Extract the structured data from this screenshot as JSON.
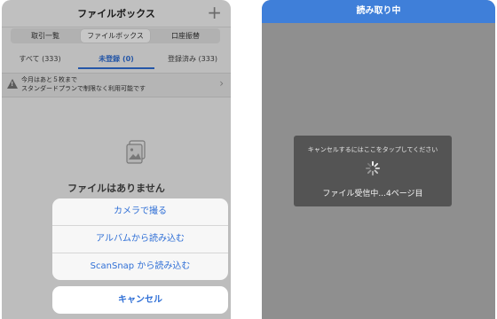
{
  "left_screen": {
    "nav_title": "ファイルボックス",
    "add_icon": "plus-icon",
    "segments": [
      "取引一覧",
      "ファイルボックス",
      "口座振替"
    ],
    "active_segment": 1,
    "tabs": [
      "すべて (333)",
      "未登録 (0)",
      "登録済み (333)"
    ],
    "active_tab": 1,
    "notice": {
      "line1": "今月はあと５枚まで",
      "line2": "スタンダードプランで制限なく利用可能です"
    },
    "empty_message": "ファイルはありません",
    "sheet_buttons": [
      "カメラで撮る",
      "アルバムから読み込む",
      "ScanSnap から読み込む"
    ],
    "cancel_label": "キャンセル",
    "accent_color": "#2f6fd6"
  },
  "right_screen": {
    "nav_title": "読み取り中",
    "tap_hint": "キャンセルするにはここをタップしてください",
    "status": "ファイル受信中...4ページ目",
    "nav_color": "#3f7fd9"
  }
}
